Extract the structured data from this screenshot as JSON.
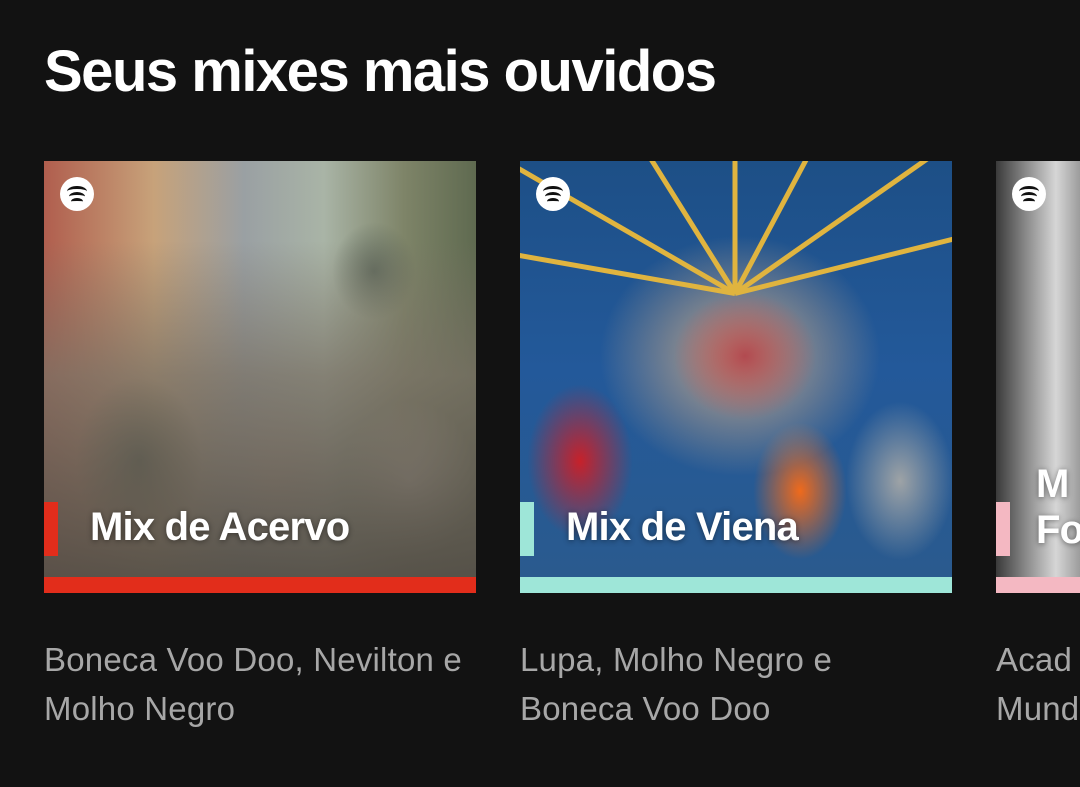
{
  "section": {
    "title": "Seus mixes mais ouvidos"
  },
  "mixes": [
    {
      "title": "Mix de Acervo",
      "subtitle": "Boneca Voo Doo, Nevilton e Molho Negro",
      "accent_color": "#e22d1b"
    },
    {
      "title": "Mix de Viena",
      "subtitle": "Lupa, Molho Negro e Boneca Voo Doo",
      "accent_color": "#9ee6d8"
    },
    {
      "title": "M\nFo",
      "subtitle": "Acad\nMund",
      "accent_color": "#f4b8c2"
    }
  ],
  "icons": {
    "cover_badge": "spotify-logo-icon"
  }
}
